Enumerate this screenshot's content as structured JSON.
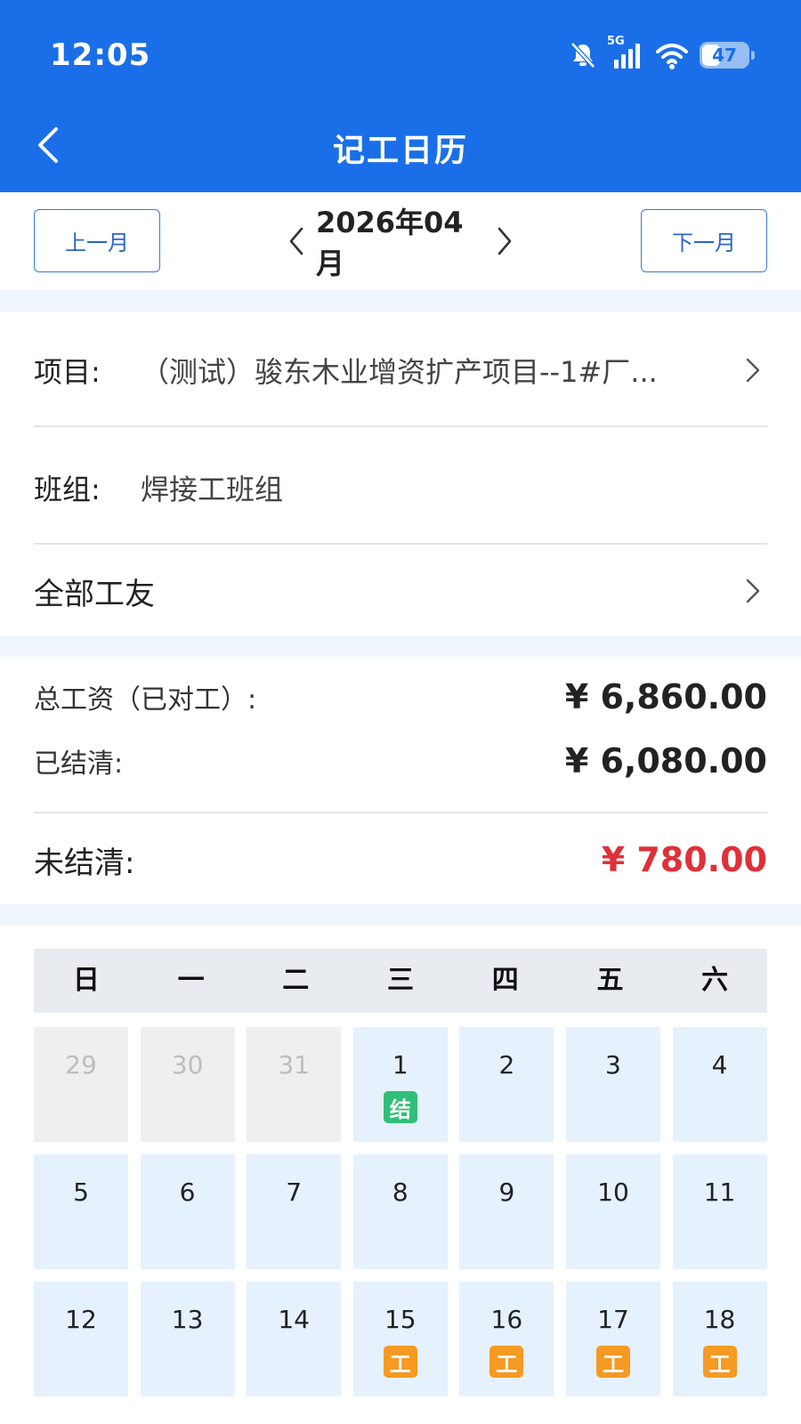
{
  "status_bar": {
    "time": "12:05",
    "network": "5G",
    "battery": "47"
  },
  "nav": {
    "title": "记工日历"
  },
  "month_nav": {
    "prev_label": "上一月",
    "next_label": "下一月",
    "current": "2026年04月"
  },
  "info": {
    "project_label": "项目:",
    "project_value": "（测试）骏东木业增资扩产项目--1#厂...",
    "team_label": "班组:",
    "team_value": "焊接工班组",
    "workers_label": "全部工友"
  },
  "wages": {
    "total_label": "总工资（已对工）:",
    "total_value": "¥ 6,860.00",
    "settled_label": "已结清:",
    "settled_value": "¥ 6,080.00",
    "unsettled_label": "未结清:",
    "unsettled_value": "¥ 780.00",
    "unsettled_color": "#e0303a"
  },
  "calendar": {
    "weekdays": [
      "日",
      "一",
      "二",
      "三",
      "四",
      "五",
      "六"
    ],
    "days": [
      {
        "day": "29",
        "other": true,
        "badge": ""
      },
      {
        "day": "30",
        "other": true,
        "badge": ""
      },
      {
        "day": "31",
        "other": true,
        "badge": ""
      },
      {
        "day": "1",
        "other": false,
        "badge": "结",
        "badge_type": "settle"
      },
      {
        "day": "2",
        "other": false,
        "badge": ""
      },
      {
        "day": "3",
        "other": false,
        "badge": ""
      },
      {
        "day": "4",
        "other": false,
        "badge": ""
      },
      {
        "day": "5",
        "other": false,
        "badge": ""
      },
      {
        "day": "6",
        "other": false,
        "badge": ""
      },
      {
        "day": "7",
        "other": false,
        "badge": ""
      },
      {
        "day": "8",
        "other": false,
        "badge": ""
      },
      {
        "day": "9",
        "other": false,
        "badge": ""
      },
      {
        "day": "10",
        "other": false,
        "badge": ""
      },
      {
        "day": "11",
        "other": false,
        "badge": ""
      },
      {
        "day": "12",
        "other": false,
        "badge": ""
      },
      {
        "day": "13",
        "other": false,
        "badge": ""
      },
      {
        "day": "14",
        "other": false,
        "badge": ""
      },
      {
        "day": "15",
        "other": false,
        "badge": "工",
        "badge_type": "work"
      },
      {
        "day": "16",
        "other": false,
        "badge": "工",
        "badge_type": "work"
      },
      {
        "day": "17",
        "other": false,
        "badge": "工",
        "badge_type": "work"
      },
      {
        "day": "18",
        "other": false,
        "badge": "工",
        "badge_type": "work"
      }
    ]
  },
  "colors": {
    "header_bg": "#1a6fe8",
    "accent": "#2a66c8",
    "settle_badge": "#2fbf78",
    "work_badge": "#f59a23",
    "cell_bg": "#e5f1fd"
  }
}
